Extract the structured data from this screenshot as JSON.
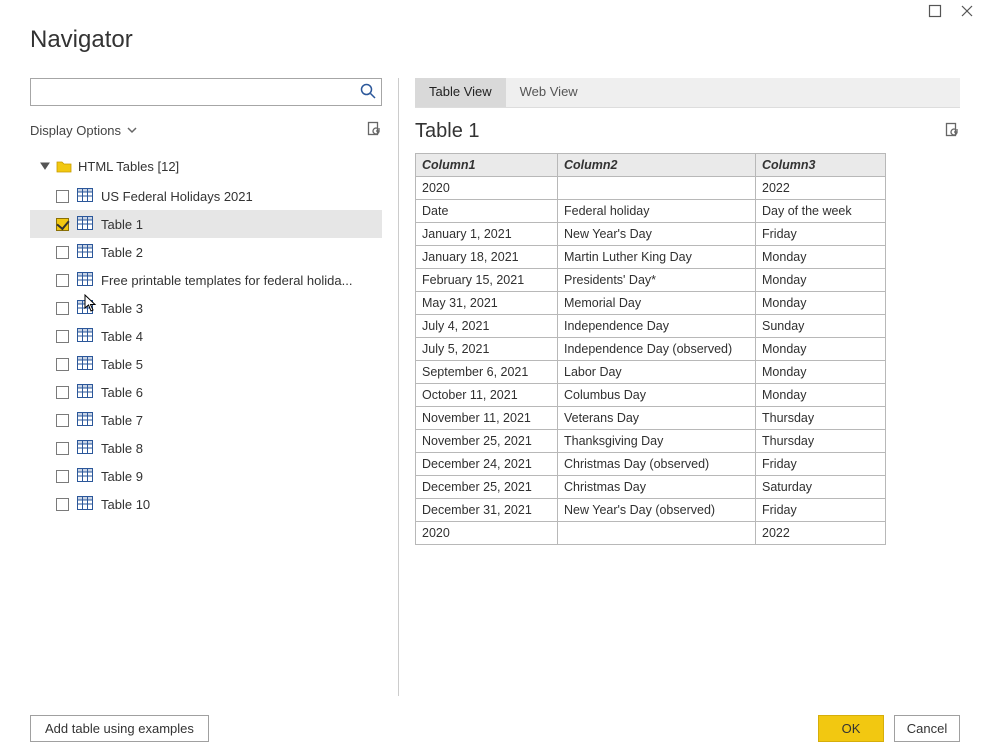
{
  "window": {
    "title": "Navigator"
  },
  "search": {
    "placeholder": ""
  },
  "display_options_label": "Display Options",
  "tree": {
    "root_label": "HTML Tables [12]",
    "items": [
      {
        "label": "US Federal Holidays 2021",
        "checked": false,
        "selected": false
      },
      {
        "label": "Table 1",
        "checked": true,
        "selected": true
      },
      {
        "label": "Table 2",
        "checked": false,
        "selected": false
      },
      {
        "label": "Free printable templates for federal holida...",
        "checked": false,
        "selected": false
      },
      {
        "label": "Table 3",
        "checked": false,
        "selected": false
      },
      {
        "label": "Table 4",
        "checked": false,
        "selected": false
      },
      {
        "label": "Table 5",
        "checked": false,
        "selected": false
      },
      {
        "label": "Table 6",
        "checked": false,
        "selected": false
      },
      {
        "label": "Table 7",
        "checked": false,
        "selected": false
      },
      {
        "label": "Table 8",
        "checked": false,
        "selected": false
      },
      {
        "label": "Table 9",
        "checked": false,
        "selected": false
      },
      {
        "label": "Table 10",
        "checked": false,
        "selected": false
      }
    ]
  },
  "tabs": [
    {
      "label": "Table View",
      "active": true
    },
    {
      "label": "Web View",
      "active": false
    }
  ],
  "preview": {
    "title": "Table 1",
    "columns": [
      "Column1",
      "Column2",
      "Column3"
    ],
    "rows": [
      [
        "2020",
        "",
        "2022"
      ],
      [
        "Date",
        "Federal holiday",
        "Day of the week"
      ],
      [
        "January 1, 2021",
        "New Year's Day",
        "Friday"
      ],
      [
        "January 18, 2021",
        "Martin Luther King Day",
        "Monday"
      ],
      [
        "February 15, 2021",
        "Presidents' Day*",
        "Monday"
      ],
      [
        "May 31, 2021",
        "Memorial Day",
        "Monday"
      ],
      [
        "July 4, 2021",
        "Independence Day",
        "Sunday"
      ],
      [
        "July 5, 2021",
        "Independence Day (observed)",
        "Monday"
      ],
      [
        "September 6, 2021",
        "Labor Day",
        "Monday"
      ],
      [
        "October 11, 2021",
        "Columbus Day",
        "Monday"
      ],
      [
        "November 11, 2021",
        "Veterans Day",
        "Thursday"
      ],
      [
        "November 25, 2021",
        "Thanksgiving Day",
        "Thursday"
      ],
      [
        "December 24, 2021",
        "Christmas Day (observed)",
        "Friday"
      ],
      [
        "December 25, 2021",
        "Christmas Day",
        "Saturday"
      ],
      [
        "December 31, 2021",
        "New Year's Day (observed)",
        "Friday"
      ],
      [
        "2020",
        "",
        "2022"
      ]
    ]
  },
  "footer": {
    "add_table_label": "Add table using examples",
    "ok_label": "OK",
    "cancel_label": "Cancel"
  }
}
